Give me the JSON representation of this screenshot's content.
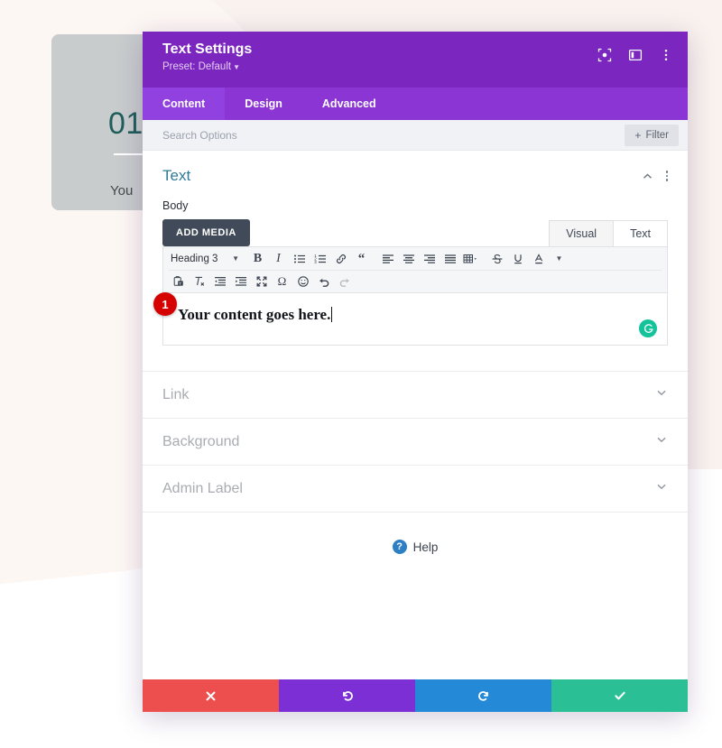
{
  "background": {
    "card": {
      "number": "01",
      "subtitle": "You"
    }
  },
  "modal": {
    "title": "Text Settings",
    "preset": "Preset: Default",
    "header_icons": [
      {
        "name": "fullscreen-icon"
      },
      {
        "name": "layout-panel-icon"
      },
      {
        "name": "kebab-menu-icon"
      }
    ],
    "tabs": [
      {
        "label": "Content",
        "active": true
      },
      {
        "label": "Design",
        "active": false
      },
      {
        "label": "Advanced",
        "active": false
      }
    ],
    "search": {
      "placeholder": "Search Options",
      "filter_label": "Filter",
      "filter_plus": "+"
    },
    "section": {
      "title": "Text",
      "field_label": "Body",
      "add_media_label": "ADD MEDIA",
      "editor_tabs": [
        {
          "label": "Visual",
          "active": true
        },
        {
          "label": "Text",
          "active": false
        }
      ],
      "toolbar": {
        "format_select": "Heading 3",
        "row1": [
          "bold-icon",
          "italic-icon",
          "bulleted-list-icon",
          "numbered-list-icon",
          "link-icon",
          "blockquote-icon",
          "align-left-icon",
          "align-center-icon",
          "align-right-icon",
          "align-justify-icon",
          "table-icon",
          "strikethrough-icon",
          "underline-icon",
          "text-color-icon"
        ],
        "row2": [
          "paste-as-text-icon",
          "clear-formatting-icon",
          "outdent-icon",
          "indent-icon",
          "fullscreen-editor-icon",
          "special-character-icon",
          "emoji-icon",
          "undo-icon",
          "redo-icon"
        ]
      },
      "content": "Your content goes here.",
      "grammarly_icon": "grammarly-icon",
      "step_badge": "1"
    },
    "accordions": [
      {
        "label": "Link"
      },
      {
        "label": "Background"
      },
      {
        "label": "Admin Label"
      }
    ],
    "help": {
      "label": "Help",
      "icon_glyph": "?"
    },
    "footer": [
      {
        "name": "cancel-button",
        "icon": "close-icon",
        "color": "#ed4f4f"
      },
      {
        "name": "undo-button",
        "icon": "undo-icon",
        "color": "#7b2fd4"
      },
      {
        "name": "redo-button",
        "icon": "redo-icon",
        "color": "#2489d6"
      },
      {
        "name": "save-button",
        "icon": "check-icon",
        "color": "#2bbf96"
      }
    ]
  },
  "colors": {
    "header_purple": "#7b26be",
    "tabs_purple": "#8a35d4",
    "tab_active_purple": "#9141e0",
    "section_title": "#2f7999",
    "badge_red": "#d50000",
    "grammarly_green": "#15c39a",
    "bg_cream": "#f9f2ee"
  }
}
